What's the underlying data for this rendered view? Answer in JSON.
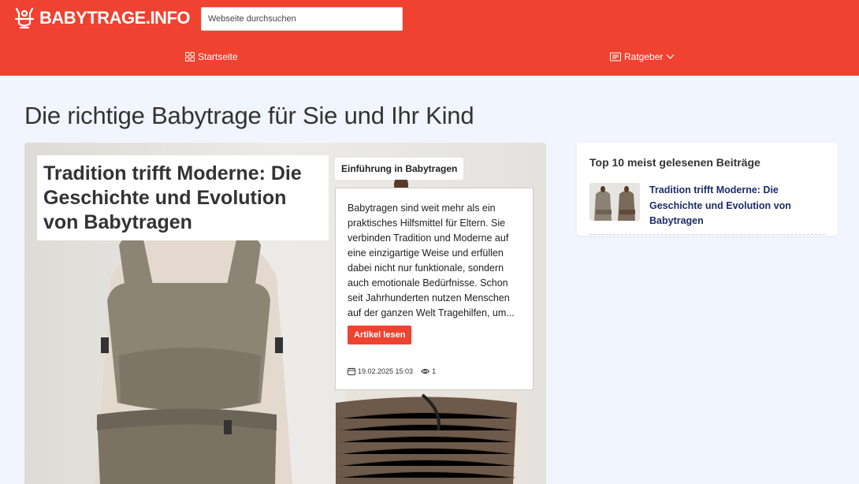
{
  "header": {
    "logo_text": "BABYTRAGE.INFO",
    "search_placeholder": "Webseite durchsuchen"
  },
  "nav": {
    "items": [
      {
        "label": "Startseite",
        "icon": "grid-icon"
      },
      {
        "label": "Ratgeber",
        "icon": "list-icon",
        "has_dropdown": true
      }
    ]
  },
  "page": {
    "title": "Die richtige Babytrage für Sie und Ihr Kind"
  },
  "featured": {
    "title": "Tradition trifft Moderne: Die Geschichte und Evolution von Babytragen",
    "category": "Einführung in Babytragen",
    "excerpt": "Babytragen sind weit mehr als ein praktisches Hilfsmittel für Eltern. Sie verbinden Tradition und Moderne auf eine einzigartige Weise und erfüllen dabei nicht nur funktionale, sondern auch emotionale Bedürfnisse. Schon seit Jahrhunderten nutzen Menschen auf der ganzen Welt Tragehilfen, um...",
    "read_more": "Artikel lesen",
    "date": "19.02.2025 15:03",
    "views": "1"
  },
  "sidebar": {
    "title": "Top 10 meist gelesenen Beiträge",
    "items": [
      {
        "title": "Tradition trifft Moderne: Die Geschichte und Evolution von Babytragen"
      }
    ]
  },
  "colors": {
    "brand": "#ef4230",
    "background": "#f1f5fd",
    "link": "#1c2d6b"
  }
}
